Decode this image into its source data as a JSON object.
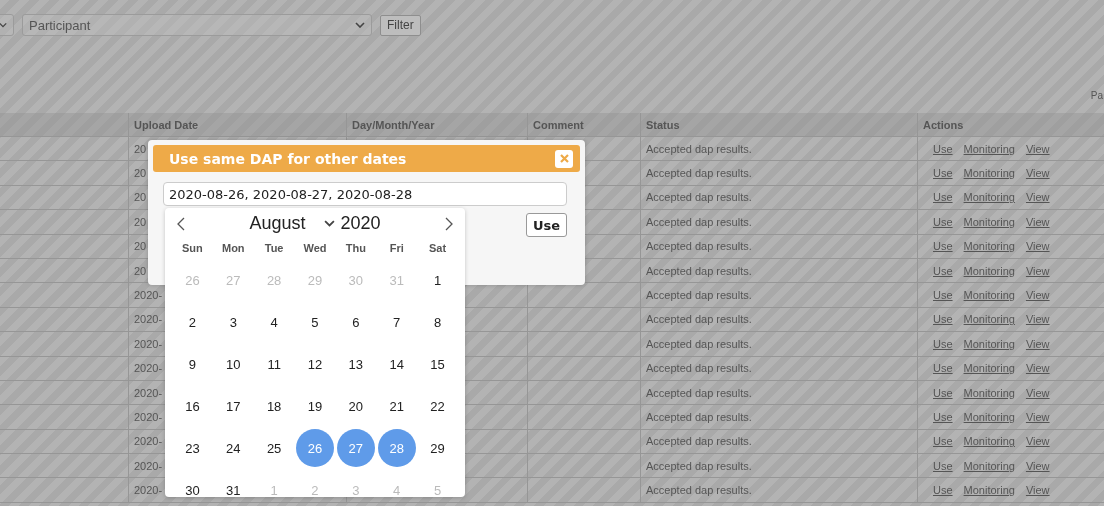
{
  "filter_bar": {
    "participant_select": {
      "value": "Participant"
    },
    "filter_button": "Filter",
    "cut_label": "Pa"
  },
  "table": {
    "columns": [
      "Upload Date",
      "Day/Month/Year",
      "Comment",
      "Status",
      "Actions"
    ],
    "rows": [
      {
        "upload_date": "20",
        "status": "Accepted dap results.",
        "actions": [
          "Use",
          "Monitoring",
          "View"
        ]
      },
      {
        "upload_date": "20",
        "status": "Accepted dap results.",
        "actions": [
          "Use",
          "Monitoring",
          "View"
        ]
      },
      {
        "upload_date": "20",
        "status": "Accepted dap results.",
        "actions": [
          "Use",
          "Monitoring",
          "View"
        ]
      },
      {
        "upload_date": "20",
        "status": "Accepted dap results.",
        "actions": [
          "Use",
          "Monitoring",
          "View"
        ]
      },
      {
        "upload_date": "20",
        "status": "Accepted dap results.",
        "actions": [
          "Use",
          "Monitoring",
          "View"
        ]
      },
      {
        "upload_date": "20",
        "status": "Accepted dap results.",
        "actions": [
          "Use",
          "Monitoring",
          "View"
        ]
      },
      {
        "upload_date": "2020-",
        "status": "Accepted dap results.",
        "actions": [
          "Use",
          "Monitoring",
          "View"
        ]
      },
      {
        "upload_date": "2020-",
        "status": "Accepted dap results.",
        "actions": [
          "Use",
          "Monitoring",
          "View"
        ]
      },
      {
        "upload_date": "2020-",
        "status": "Accepted dap results.",
        "actions": [
          "Use",
          "Monitoring",
          "View"
        ]
      },
      {
        "upload_date": "2020-",
        "status": "Accepted dap results.",
        "actions": [
          "Use",
          "Monitoring",
          "View"
        ]
      },
      {
        "upload_date": "2020-",
        "status": "Accepted dap results.",
        "actions": [
          "Use",
          "Monitoring",
          "View"
        ]
      },
      {
        "upload_date": "2020-",
        "status": "Accepted dap results.",
        "actions": [
          "Use",
          "Monitoring",
          "View"
        ]
      },
      {
        "upload_date": "2020-",
        "status": "Accepted dap results.",
        "actions": [
          "Use",
          "Monitoring",
          "View"
        ]
      },
      {
        "upload_date": "2020-",
        "status": "Accepted dap results.",
        "actions": [
          "Use",
          "Monitoring",
          "View"
        ]
      },
      {
        "upload_date": "2020-",
        "status": "Accepted dap results.",
        "actions": [
          "Use",
          "Monitoring",
          "View"
        ]
      }
    ]
  },
  "dialog": {
    "title": "Use same DAP for other dates",
    "dates_field": {
      "value": "2020-08-26, 2020-08-27, 2020-08-28"
    },
    "use_button": "Use"
  },
  "calendar": {
    "month": "August",
    "year": "2020",
    "weekdays": [
      "Sun",
      "Mon",
      "Tue",
      "Wed",
      "Thu",
      "Fri",
      "Sat"
    ],
    "weeks": [
      [
        {
          "label": "26",
          "outside": true,
          "selected": false
        },
        {
          "label": "27",
          "outside": true,
          "selected": false
        },
        {
          "label": "28",
          "outside": true,
          "selected": false
        },
        {
          "label": "29",
          "outside": true,
          "selected": false
        },
        {
          "label": "30",
          "outside": true,
          "selected": false
        },
        {
          "label": "31",
          "outside": true,
          "selected": false
        },
        {
          "label": "1",
          "outside": false,
          "selected": false
        }
      ],
      [
        {
          "label": "2",
          "outside": false,
          "selected": false
        },
        {
          "label": "3",
          "outside": false,
          "selected": false
        },
        {
          "label": "4",
          "outside": false,
          "selected": false
        },
        {
          "label": "5",
          "outside": false,
          "selected": false
        },
        {
          "label": "6",
          "outside": false,
          "selected": false
        },
        {
          "label": "7",
          "outside": false,
          "selected": false
        },
        {
          "label": "8",
          "outside": false,
          "selected": false
        }
      ],
      [
        {
          "label": "9",
          "outside": false,
          "selected": false
        },
        {
          "label": "10",
          "outside": false,
          "selected": false
        },
        {
          "label": "11",
          "outside": false,
          "selected": false
        },
        {
          "label": "12",
          "outside": false,
          "selected": false
        },
        {
          "label": "13",
          "outside": false,
          "selected": false
        },
        {
          "label": "14",
          "outside": false,
          "selected": false
        },
        {
          "label": "15",
          "outside": false,
          "selected": false
        }
      ],
      [
        {
          "label": "16",
          "outside": false,
          "selected": false
        },
        {
          "label": "17",
          "outside": false,
          "selected": false
        },
        {
          "label": "18",
          "outside": false,
          "selected": false
        },
        {
          "label": "19",
          "outside": false,
          "selected": false
        },
        {
          "label": "20",
          "outside": false,
          "selected": false
        },
        {
          "label": "21",
          "outside": false,
          "selected": false
        },
        {
          "label": "22",
          "outside": false,
          "selected": false
        }
      ],
      [
        {
          "label": "23",
          "outside": false,
          "selected": false
        },
        {
          "label": "24",
          "outside": false,
          "selected": false
        },
        {
          "label": "25",
          "outside": false,
          "selected": false
        },
        {
          "label": "26",
          "outside": false,
          "selected": true
        },
        {
          "label": "27",
          "outside": false,
          "selected": true
        },
        {
          "label": "28",
          "outside": false,
          "selected": true
        },
        {
          "label": "29",
          "outside": false,
          "selected": false
        }
      ],
      [
        {
          "label": "30",
          "outside": false,
          "selected": false
        },
        {
          "label": "31",
          "outside": false,
          "selected": false
        },
        {
          "label": "1",
          "outside": true,
          "selected": false
        },
        {
          "label": "2",
          "outside": true,
          "selected": false
        },
        {
          "label": "3",
          "outside": true,
          "selected": false
        },
        {
          "label": "4",
          "outside": true,
          "selected": false
        },
        {
          "label": "5",
          "outside": true,
          "selected": false
        }
      ]
    ]
  }
}
